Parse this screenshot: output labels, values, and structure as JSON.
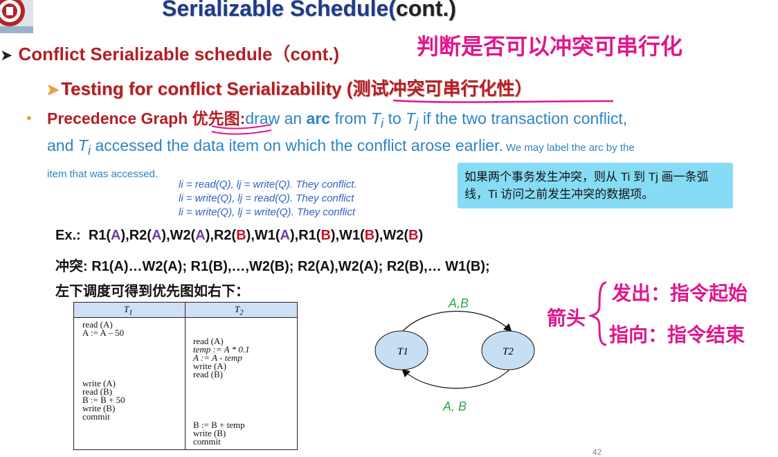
{
  "header": {
    "title_main": "Serializable Schedule(",
    "title_cont": "cont.)"
  },
  "level1": {
    "text": "Conflict Serializable schedule（cont.)"
  },
  "level2": {
    "text": "Testing for conflict Serializability (测试冲突可串行化性）"
  },
  "annotation_top": "判断是否可以冲突可串行化",
  "para": {
    "pg_label": "Precedence Graph 优先图",
    "sep": ":",
    "t1": "draw an ",
    "arc": "arc",
    "t2": " from ",
    "ti": "T",
    "ti_sub": "i",
    "t3": " to ",
    "tj": "T",
    "tj_sub": "j",
    "t4": " if the two transaction conflict, and ",
    "ti2": "T",
    "ti2_sub": "i",
    "t5": " accessed the data item on which the conflict arose earlier.",
    "small": " We may label the arc by the item that was accessed."
  },
  "rules": [
    "li = read(Q),  lj = write(Q).  They conflict.",
    "li = write(Q), lj = read(Q).   They conflict",
    "li = write(Q), lj = write(Q).  They conflict"
  ],
  "note": "如果两个事务发生冲突，则从 Ti 到 Tj 画一条弧线，Ti 访问之前发生冲突的数据项。",
  "example": {
    "label": "Ex.:",
    "ops": [
      [
        "R1(",
        "A",
        "),"
      ],
      [
        "R2(",
        "A",
        "),"
      ],
      [
        "W2(",
        "A",
        "),"
      ],
      [
        "R2(",
        "B",
        "),"
      ],
      [
        "W1(",
        "A",
        "),"
      ],
      [
        "R1(",
        "B",
        "),"
      ],
      [
        "W1(",
        "B",
        "),"
      ],
      [
        "W2(",
        "B",
        ")"
      ]
    ]
  },
  "conflict_line": {
    "label": "冲突",
    "text": "R1(A)…W2(A);  R1(B),…,W2(B); R2(A),W2(A); R2(B),… W1(B);"
  },
  "schedule_note": "左下调度可得到优先图如右下：",
  "schedule": {
    "headers": [
      "T1",
      "T2"
    ],
    "t1_block1": [
      "read (A)",
      "A := A – 50"
    ],
    "t2_block1": [
      "read (A)",
      "temp := A * 0.1",
      "A := A - temp",
      "write (A)",
      "read (B)"
    ],
    "t1_block2": [
      "write (A)",
      "read (B)",
      "B := B + 50",
      "write (B)",
      "commit"
    ],
    "t2_block2": [
      "B := B + temp",
      "write (B)",
      "commit"
    ]
  },
  "graph": {
    "node1": "T1",
    "node2": "T2",
    "edge_top_label": "A,B",
    "edge_bottom_label": "A, B",
    "edge_color": "#2aa84a"
  },
  "annotation_right": {
    "brace_label": "箭头",
    "line1": "发出：指令起始",
    "line2": "指向：指令结束"
  },
  "page_number": "42",
  "colors": {
    "title": "#1f3a86",
    "heading": "#b21f24",
    "body": "#2d84c4",
    "note_bg": "#86dcf4",
    "ink": "#e0168c"
  }
}
